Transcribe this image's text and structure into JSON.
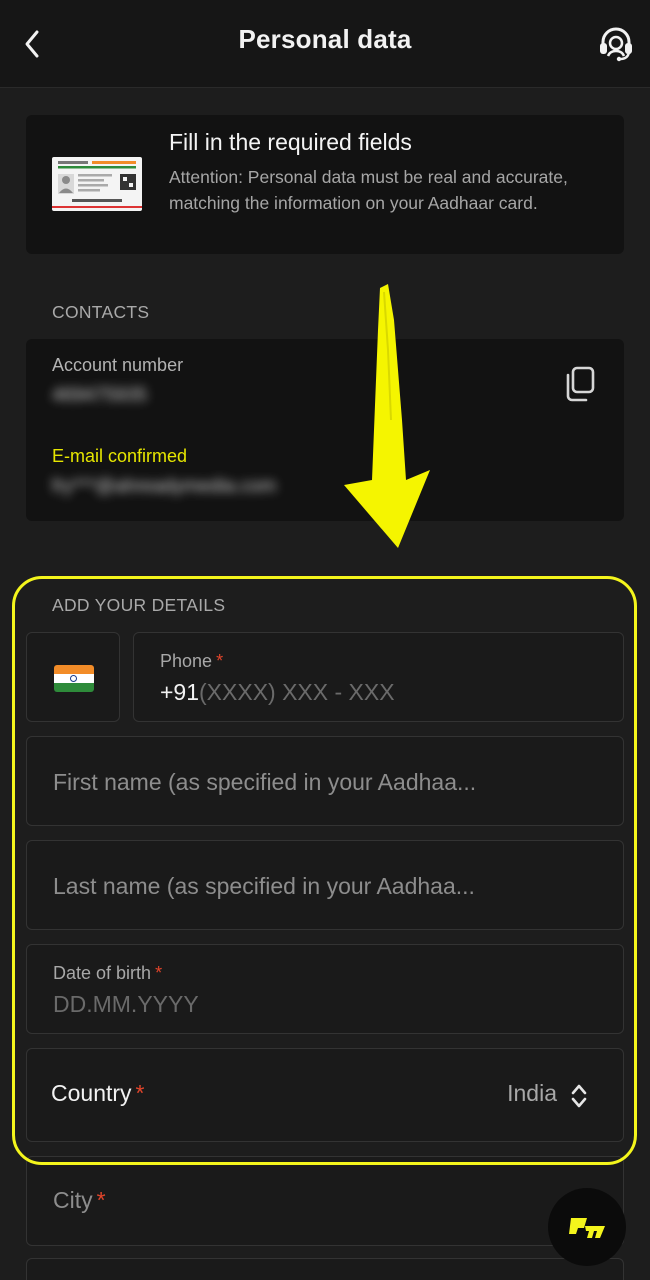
{
  "header": {
    "title": "Personal data"
  },
  "info": {
    "title": "Fill in the required fields",
    "text": "Attention: Personal data must be real and accurate, matching the information on your Aadhaar card."
  },
  "contacts": {
    "section_label": "CONTACTS",
    "account_label": "Account number",
    "account_value": "469475935",
    "email_label": "E-mail confirmed",
    "email_value": "fry***@ahreadymedia.com"
  },
  "details": {
    "section_label": "ADD YOUR DETAILS",
    "phone_label": "Phone",
    "required_mark": "*",
    "phone_prefix": "+91",
    "phone_mask": "(XXXX) XXX - XXX",
    "first_name_placeholder": "First name (as specified in your Aadhaa...",
    "last_name_placeholder": "Last name (as specified in your Aadhaa...",
    "dob_label": "Date of birth",
    "dob_placeholder": "DD.MM.YYYY",
    "country_label": "Country",
    "country_value": "India",
    "city_label": "City"
  },
  "colors": {
    "background": "#1d1d1d",
    "card": "#121212",
    "highlight": "#f4f51c",
    "required": "#e2452b",
    "email_confirmed": "#e6e600"
  },
  "icons": [
    "back-chevron-icon",
    "support-headset-icon",
    "aadhaar-card-icon",
    "copy-icon",
    "india-flag-icon",
    "sort-arrows-icon",
    "parimatch-logo-icon"
  ]
}
